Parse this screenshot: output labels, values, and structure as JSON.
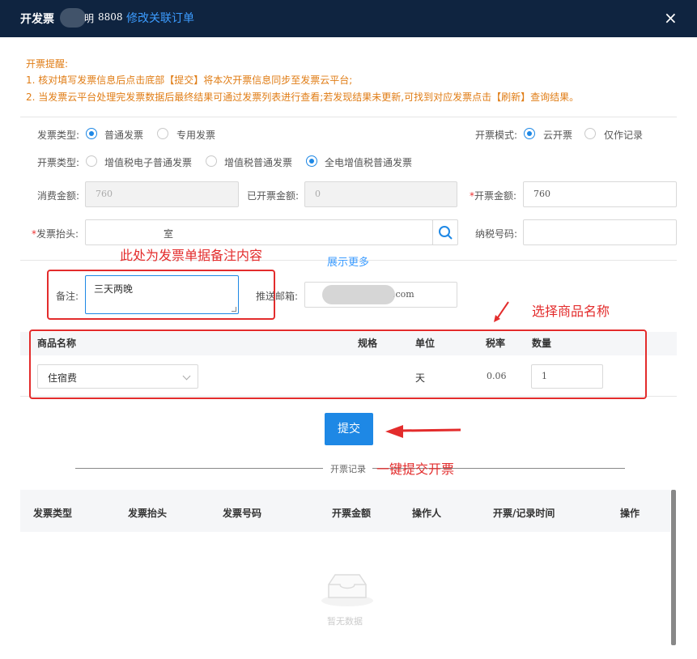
{
  "header": {
    "title": "开发票",
    "title_suffix": "明",
    "order_no": "8808",
    "edit_link": "修改关联订单",
    "close": "×"
  },
  "notice": {
    "heading": "开票提醒:",
    "line1": "1. 核对填写发票信息后点击底部【提交】将本次开票信息同步至发票云平台;",
    "line2": "2. 当发票云平台处理完发票数据后最终结果可通过发票列表进行查看;若发现结果未更新,可找到对应发票点击【刷新】查询结果。"
  },
  "form": {
    "invoice_type_label": "发票类型:",
    "invoice_type_options": [
      "普通发票",
      "专用发票"
    ],
    "mode_label": "开票模式:",
    "mode_options": [
      "云开票",
      "仅作记录"
    ],
    "kind_label": "开票类型:",
    "kind_options": [
      "增值税电子普通发票",
      "增值税普通发票",
      "全电增值税普通发票"
    ],
    "consume_label": "消费金额:",
    "consume_value": "760",
    "issued_label": "已开票金额:",
    "issued_value": "0",
    "amount_label": "开票金额:",
    "amount_value": "760",
    "header_label": "发票抬头:",
    "header_value": "室",
    "taxno_label": "纳税号码:",
    "taxno_value": "",
    "show_more": "展示更多",
    "remark_label": "备注:",
    "remark_value": "三天两晚",
    "email_label": "推送邮箱:",
    "email_value": ".com"
  },
  "annotations": {
    "remark_note": "此处为发票单据备注内容",
    "goods_note": "选择商品名称",
    "submit_note": "一键提交开票",
    "color": "#e32c2c"
  },
  "goods_table": {
    "headers": [
      "商品名称",
      "规格",
      "单位",
      "税率",
      "数量"
    ],
    "row": {
      "name": "住宿费",
      "spec": "",
      "unit": "天",
      "rate": "0.06",
      "qty": "1"
    }
  },
  "submit_label": "提交",
  "records": {
    "title": "开票记录",
    "headers": [
      "发票类型",
      "发票抬头",
      "发票号码",
      "开票金额",
      "操作人",
      "开票/记录时间",
      "操作"
    ],
    "empty_text": "暂无数据"
  },
  "colors": {
    "titlebar": "#0f2440",
    "link": "#3c9cff",
    "primary": "#1e88e5",
    "notice": "#e07d16"
  }
}
